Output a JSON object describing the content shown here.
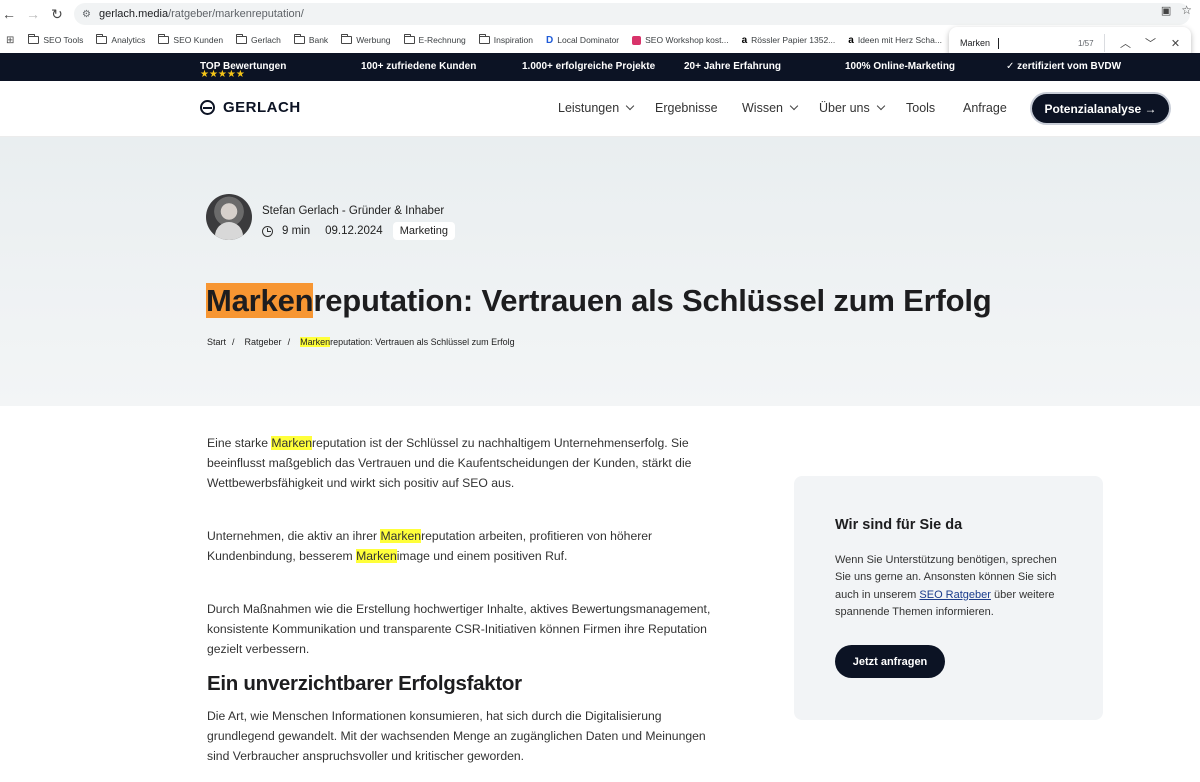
{
  "browser": {
    "url_host": "gerlach.media",
    "url_path": "/ratgeber/markenreputation/",
    "bookmarks": [
      "SEO Tools",
      "Analytics",
      "SEO Kunden",
      "Gerlach",
      "Bank",
      "Werbung",
      "E-Rechnung",
      "Inspiration",
      "Local Dominator",
      "SEO Workshop kost...",
      "Rössler Papier 1352...",
      "Ideen mit Herz Scha..."
    ],
    "find": {
      "query": "Marken",
      "count": "1/57"
    }
  },
  "topbar": {
    "stars": "★★★★★",
    "items": [
      "TOP Bewertungen",
      "100+ zufriedene Kunden",
      "1.000+ erfolgreiche Projekte",
      "20+ Jahre Erfahrung",
      "100% Online-Marketing",
      "✓ zertifiziert vom BVDW"
    ]
  },
  "header": {
    "logo": "GERLACH",
    "menu": [
      "Leistungen",
      "Ergebnisse",
      "Wissen",
      "Über uns",
      "Tools",
      "Anfrage"
    ],
    "cta": "Potenzialanalyse →"
  },
  "hero": {
    "author": "Stefan Gerlach - Gründer & Inhaber",
    "read_time": "9 min",
    "date": "09.12.2024",
    "tag": "Marketing",
    "title_highlight": "Marken",
    "title_rest": "reputation: Vertrauen als Schlüssel zum Erfolg",
    "breadcrumb": [
      "Start",
      "Ratgeber"
    ],
    "breadcrumb_current_highlight": "Marken",
    "breadcrumb_current_rest": "reputation: Vertrauen als Schlüssel zum Erfolg"
  },
  "content": {
    "p1": [
      "Eine starke ",
      "Marken",
      "reputation ist der Schlüssel zu nachhaltigem Unternehmenserfolg. Sie beeinflusst maßgeblich das Vertrauen und die Kaufentscheidungen der Kunden, stärkt die Wettbewerbsfähigkeit und wirkt sich positiv auf SEO aus."
    ],
    "p2": [
      "Unternehmen, die aktiv an ihrer ",
      "Marken",
      "reputation arbeiten, profitieren von höherer Kundenbindung, besserem ",
      "Marken",
      "image und einem positiven Ruf."
    ],
    "p3": "Durch Maßnahmen wie die Erstellung hochwertiger Inhalte, aktives Bewertungsmanagement, konsistente Kommunikation und transparente CSR-Initiativen können Firmen ihre Reputation gezielt verbessern.",
    "h2": "Ein unverzichtbarer Erfolgsfaktor",
    "p4": "Die Art, wie Menschen Informationen konsumieren, hat sich durch die Digitalisierung grundlegend gewandelt. Mit der wachsenden Menge an zugänglichen Daten und Meinungen sind Verbraucher anspruchsvoller und kritischer geworden."
  },
  "sidebar": {
    "title": "Wir sind für Sie da",
    "text_before": "Wenn Sie Unterstützung benötigen, sprechen Sie uns gerne an. Ansonsten können Sie sich auch in unserem ",
    "link": "SEO Ratgeber",
    "text_after": " über weitere spannende Themen informieren.",
    "button": "Jetzt anfragen"
  },
  "colors": {
    "navy": "#0c1324",
    "find_current": "#f79632",
    "find_match": "#ffff3a"
  }
}
